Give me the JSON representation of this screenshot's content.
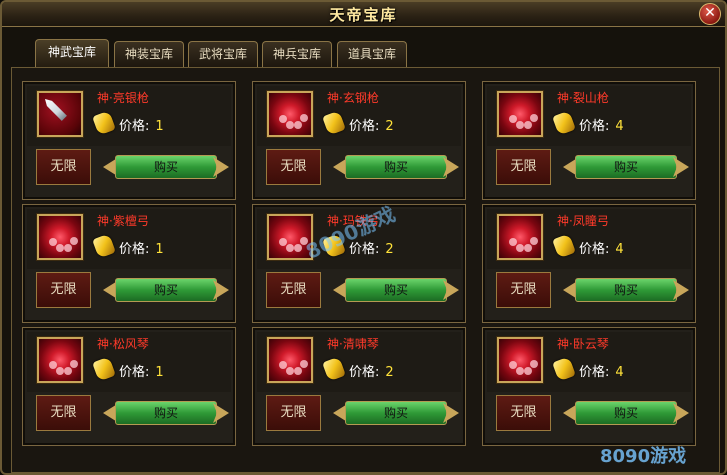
{
  "window": {
    "title": "天帝宝库",
    "close_label": "✕"
  },
  "tabs": [
    {
      "label": "神武宝库",
      "active": true
    },
    {
      "label": "神装宝库",
      "active": false
    },
    {
      "label": "武将宝库",
      "active": false
    },
    {
      "label": "神兵宝库",
      "active": false
    },
    {
      "label": "道具宝库",
      "active": false
    }
  ],
  "price_label": "价格:",
  "items": [
    {
      "name": "神·亮银枪",
      "price": "1",
      "limit": "无限",
      "buy": "购买",
      "icon": "spear-icon"
    },
    {
      "name": "神·玄钢枪",
      "price": "2",
      "limit": "无限",
      "buy": "购买",
      "icon": "red-gem-icon"
    },
    {
      "name": "神·裂山枪",
      "price": "4",
      "limit": "无限",
      "buy": "购买",
      "icon": "red-gem-icon"
    },
    {
      "name": "神·紫檀弓",
      "price": "1",
      "limit": "无限",
      "buy": "购买",
      "icon": "red-gem-icon"
    },
    {
      "name": "神·玛铁弓",
      "price": "2",
      "limit": "无限",
      "buy": "购买",
      "icon": "red-gem-icon"
    },
    {
      "name": "神·凤瞳弓",
      "price": "4",
      "limit": "无限",
      "buy": "购买",
      "icon": "red-gem-icon"
    },
    {
      "name": "神·松风琴",
      "price": "1",
      "limit": "无限",
      "buy": "购买",
      "icon": "red-gem-icon"
    },
    {
      "name": "神·清啸琴",
      "price": "2",
      "limit": "无限",
      "buy": "购买",
      "icon": "red-gem-icon"
    },
    {
      "name": "神·卧云琴",
      "price": "4",
      "limit": "无限",
      "buy": "购买",
      "icon": "red-gem-icon"
    }
  ],
  "watermark": {
    "logo_text": "8090游戏"
  },
  "colors": {
    "item_name": "#ff3a2a",
    "price_value": "#ffe23a",
    "buy_button": "#2f9a37",
    "frame_gold": "#c8a65a"
  }
}
